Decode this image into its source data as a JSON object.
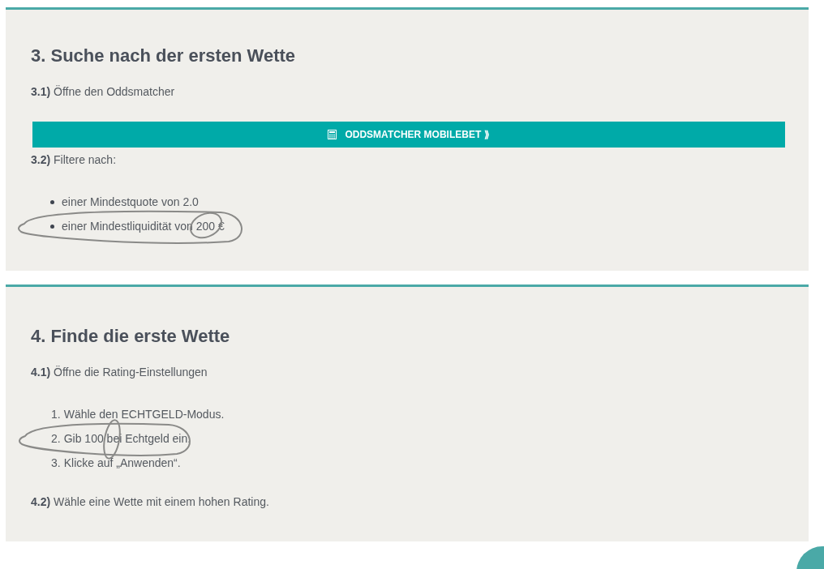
{
  "sections": [
    {
      "blocks": [
        {
          "kind": "heading",
          "text": "3. Suche nach der ersten Wette"
        },
        {
          "kind": "step",
          "text": "**3.1)** Öffne den Oddsmatcher"
        },
        {
          "kind": "button",
          "text": "ODDSMATCHER MOBILEBET ⟫"
        },
        {
          "kind": "step",
          "text": "**3.2)** Filtere nach:"
        },
        {
          "kind": "bullets",
          "items": [
            {
              "text": "einer Mindestquote von 2.0",
              "circled": false
            },
            {
              "text": "einer Mindestliquidität von 200 €",
              "circled": true
            }
          ]
        }
      ]
    },
    {
      "blocks": [
        {
          "kind": "heading",
          "text": "4. Finde die erste Wette"
        },
        {
          "kind": "step",
          "text": "**4.1)** Öffne die Rating-Einstellungen"
        },
        {
          "kind": "numbered",
          "items": [
            {
              "number": "1.",
              "text": "Wähle den ECHTGELD-Modus.",
              "circled": false
            },
            {
              "number": "2.",
              "text": "Gib 100 bei Echtgeld ein.",
              "circled": true
            },
            {
              "number": "3.",
              "text": "Klicke auf „Anwenden“.",
              "circled": false
            }
          ]
        },
        {
          "kind": "step",
          "text": "**4.2)** Wähle eine Wette mit einem hohen Rating."
        }
      ]
    }
  ]
}
